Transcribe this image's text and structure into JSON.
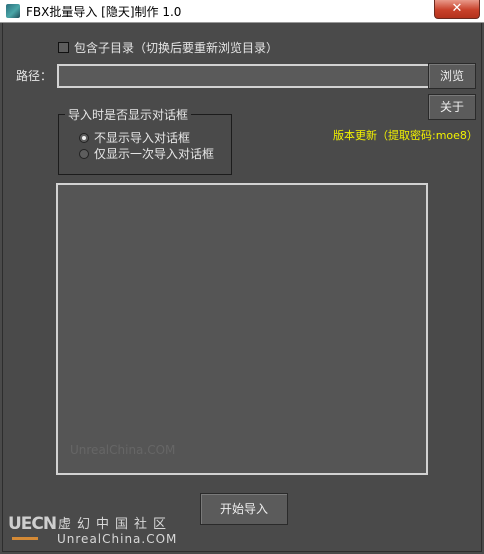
{
  "window": {
    "title": "FBX批量导入 [隐天]制作 1.0",
    "close_glyph": "✕"
  },
  "options": {
    "include_subdirs_label": "包含子目录（切换后要重新浏览目录）"
  },
  "path": {
    "label": "路径：",
    "value": ""
  },
  "buttons": {
    "browse": "浏览",
    "about": "关于",
    "import": "开始导入"
  },
  "update_link": "版本更新（提取密码:moe8）",
  "dialog_group": {
    "title": "导入时是否显示对话框",
    "options": [
      "不显示导入对话框",
      "仅显示一次导入对话框"
    ]
  },
  "list_watermark": "UnrealChina.COM",
  "footer": {
    "logo": "UECN",
    "brand_cn": "虚幻中国社区",
    "brand_en": "UnrealChina.COM"
  },
  "colors": {
    "background": "#4a4a4a",
    "link": "#f2f200",
    "close": "#c8412a"
  }
}
